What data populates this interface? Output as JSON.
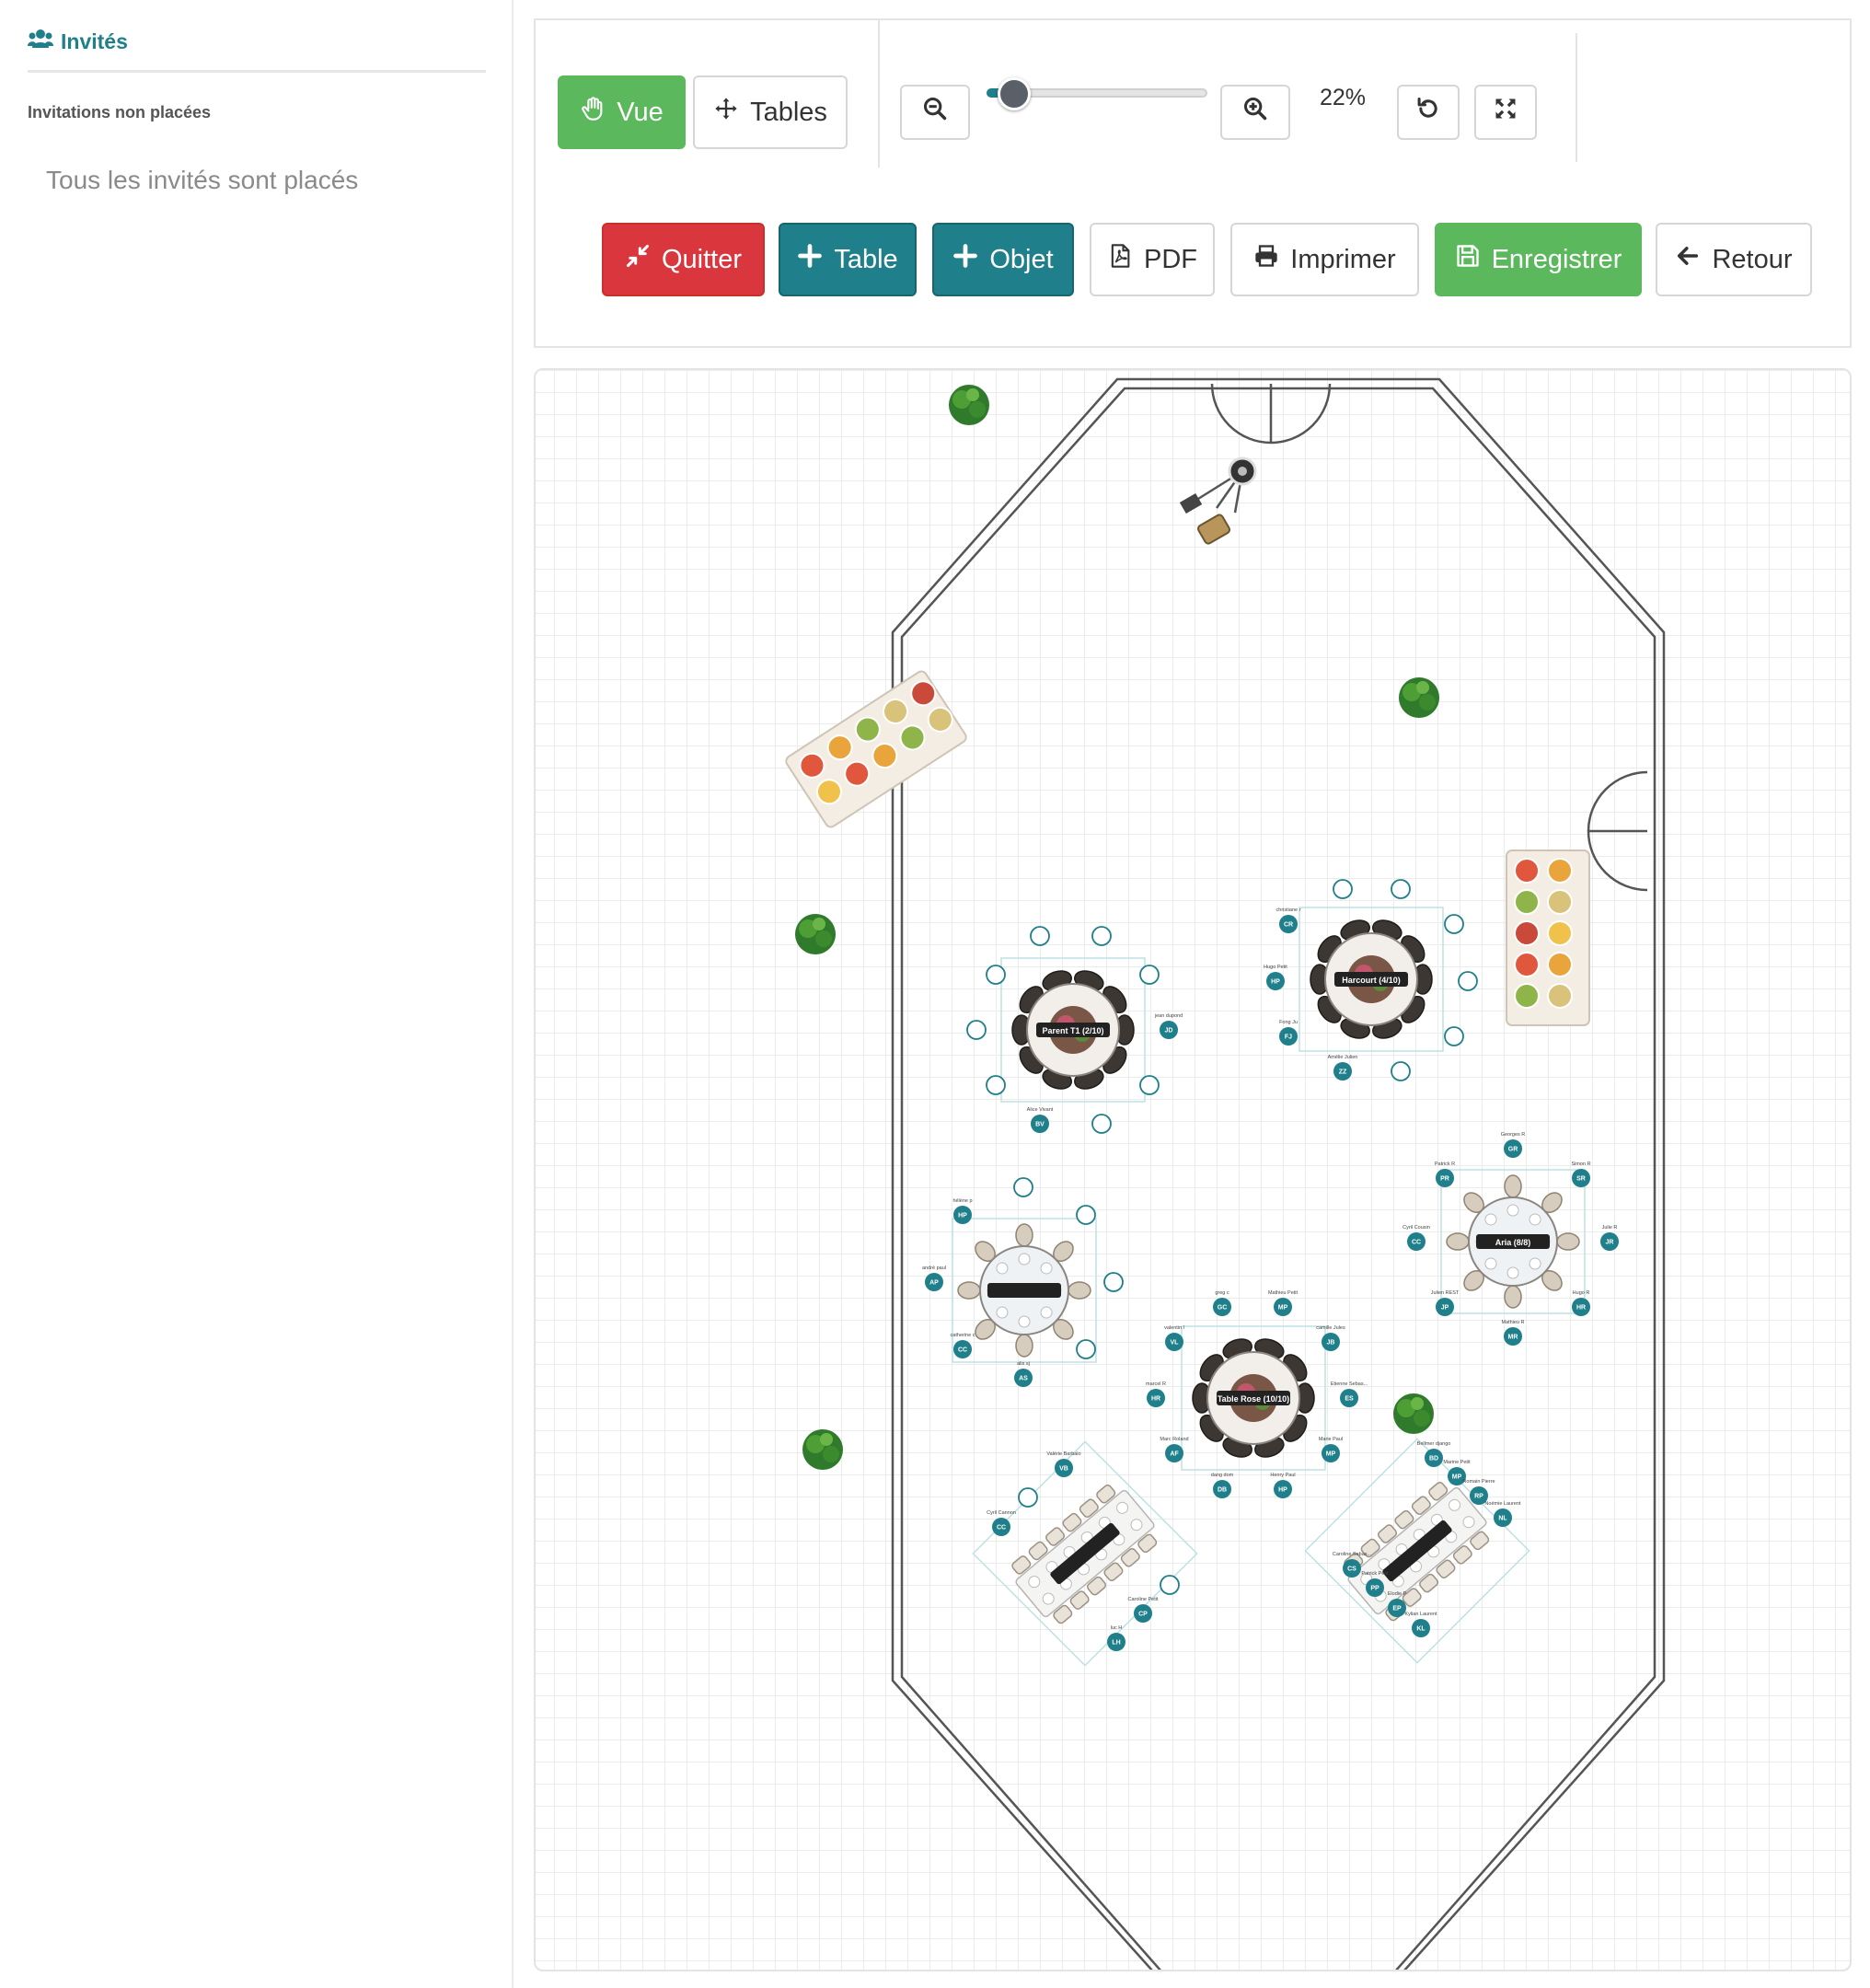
{
  "sidebar": {
    "title": "Invités",
    "unplaced_heading": "Invitations non placées",
    "empty_message": "Tous les invités sont placés"
  },
  "toolbar": {
    "mode_view_label": "Vue",
    "mode_tables_label": "Tables",
    "zoom_label": "22%",
    "zoom_value_percent": 22,
    "quit_label": "Quitter",
    "add_table_label": "Table",
    "add_object_label": "Objet",
    "pdf_label": "PDF",
    "print_label": "Imprimer",
    "save_label": "Enregistrer",
    "back_label": "Retour"
  },
  "colors": {
    "accent_teal": "#1f7f8a",
    "success_green": "#5cb85c",
    "danger_red": "#d9363e"
  },
  "plan": {
    "tables": [
      {
        "label": "Parent T1 (2/10)",
        "guests": [
          {
            "name": "jean dupond",
            "initials": "JD"
          },
          {
            "name": "Alice Vivant",
            "initials": "BV"
          }
        ]
      },
      {
        "label": "Harcourt (4/10)",
        "guests": [
          {
            "name": "christiane r",
            "initials": "CR"
          },
          {
            "name": "Hugo Petit",
            "initials": "HP"
          },
          {
            "name": "Fong Ju",
            "initials": "FJ"
          },
          {
            "name": "Amélie Julien",
            "initials": "ZZ"
          }
        ]
      },
      {
        "label": "Aria (8/8)",
        "guests": [
          {
            "name": "Georges R",
            "initials": "GR"
          },
          {
            "name": "Patrick R",
            "initials": "PR"
          },
          {
            "name": "Simon R",
            "initials": "SR"
          },
          {
            "name": "Cyril Cousin",
            "initials": "CC"
          },
          {
            "name": "Julie R",
            "initials": "JR"
          },
          {
            "name": "Julien REST",
            "initials": "JP"
          },
          {
            "name": "Hugo R",
            "initials": "HR"
          },
          {
            "name": "Mathieu R",
            "initials": "MR"
          }
        ]
      },
      {
        "label": "",
        "guests": [
          {
            "name": "hélène p",
            "initials": "HP"
          },
          {
            "name": "andré paul",
            "initials": "AP"
          },
          {
            "name": "catherine c",
            "initials": "CC"
          },
          {
            "name": "alix sj",
            "initials": "AS"
          }
        ]
      },
      {
        "label": "Table Rose (10/10)",
        "guests": [
          {
            "name": "greg c",
            "initials": "GC"
          },
          {
            "name": "Mathieu Petit",
            "initials": "MP"
          },
          {
            "name": "valentin l",
            "initials": "VL"
          },
          {
            "name": "camille Jules",
            "initials": "JB"
          },
          {
            "name": "marcel R",
            "initials": "HR"
          },
          {
            "name": "Etienne Sebas...",
            "initials": "ES"
          },
          {
            "name": "Marc Roland",
            "initials": "AF"
          },
          {
            "name": "Marie Paul",
            "initials": "MP"
          },
          {
            "name": "dang dom",
            "initials": "DB"
          },
          {
            "name": "Henry Paul",
            "initials": "HP"
          }
        ]
      },
      {
        "label": "",
        "guests": [
          {
            "name": "Valérie Barbalo",
            "initials": "VB"
          },
          {
            "name": "Cyril Cannon",
            "initials": "CC"
          },
          {
            "name": "Caroline Petit",
            "initials": "CP"
          },
          {
            "name": "luc H",
            "initials": "LH"
          }
        ]
      },
      {
        "label": "",
        "guests": [
          {
            "name": "Bellmer django",
            "initials": "BD"
          },
          {
            "name": "Marine Petit",
            "initials": "MP"
          },
          {
            "name": "Romain Pierre",
            "initials": "RP"
          },
          {
            "name": "Noémie Laurent",
            "initials": "NL"
          },
          {
            "name": "Caroline Sebas...",
            "initials": "CS"
          },
          {
            "name": "Patrick Petit",
            "initials": "PP"
          },
          {
            "name": "Elodie P",
            "initials": "EP"
          },
          {
            "name": "Kylian Laurent",
            "initials": "KL"
          }
        ]
      }
    ]
  }
}
